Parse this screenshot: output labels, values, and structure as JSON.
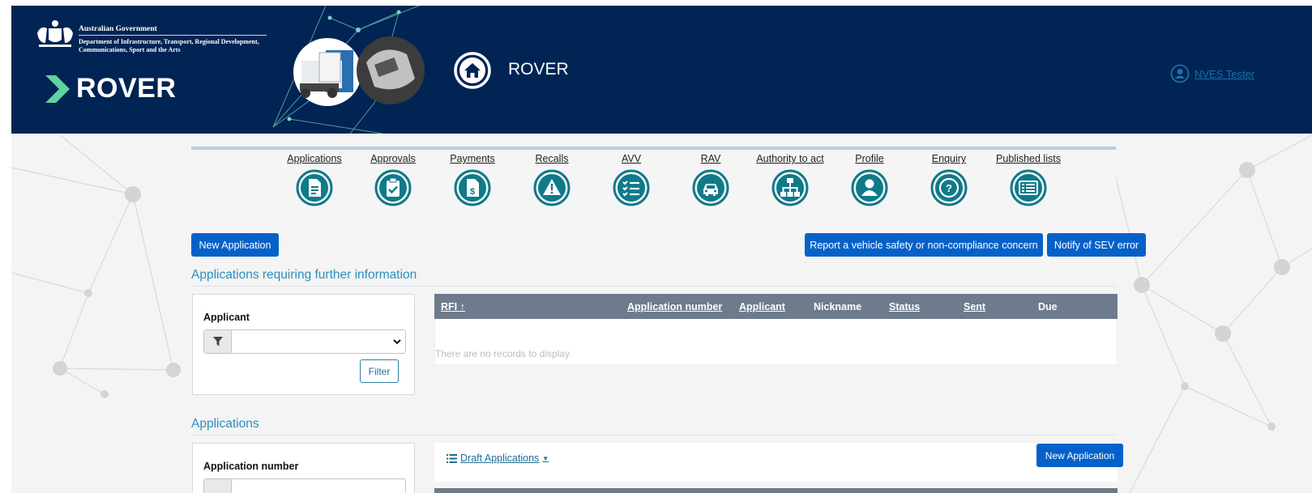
{
  "header": {
    "gov_title": "Australian Government",
    "department": "Department of Infrastructure, Transport, Regional Development, Communications, Sport and the Arts",
    "logo_text": "ROVER",
    "app_title": "ROVER",
    "user_name": "NVES Tester",
    "colors": {
      "header_bg": "#002454",
      "accent_green": "#5fd3a0"
    }
  },
  "nav": {
    "items": [
      {
        "label": "Applications",
        "icon": "document-icon"
      },
      {
        "label": "Approvals",
        "icon": "clipboard-check-icon"
      },
      {
        "label": "Payments",
        "icon": "dollar-document-icon"
      },
      {
        "label": "Recalls",
        "icon": "warning-icon"
      },
      {
        "label": "AVV",
        "icon": "checklist-icon"
      },
      {
        "label": "RAV",
        "icon": "car-icon"
      },
      {
        "label": "Authority to act",
        "icon": "org-chart-icon"
      },
      {
        "label": "Profile",
        "icon": "person-icon"
      },
      {
        "label": "Enquiry",
        "icon": "question-icon"
      },
      {
        "label": "Published lists",
        "icon": "list-icon"
      }
    ],
    "icon_color": "#0f7a8a"
  },
  "actions": {
    "new_application": "New Application",
    "report_concern": "Report a vehicle safety or non-compliance concern",
    "notify_sev": "Notify of SEV error",
    "button_color": "#0561c9"
  },
  "rfi_section": {
    "title": "Applications requiring further information",
    "filter": {
      "label": "Applicant",
      "selected": "",
      "button": "Filter"
    },
    "columns": [
      "RFI",
      "Application number",
      "Applicant",
      "Nickname",
      "Status",
      "Sent",
      "Due"
    ],
    "empty_message": "There are no records to display."
  },
  "applications_section": {
    "title": "Applications",
    "filter": {
      "label": "Application number"
    },
    "view_selector": "Draft Applications",
    "new_button": "New Application"
  }
}
